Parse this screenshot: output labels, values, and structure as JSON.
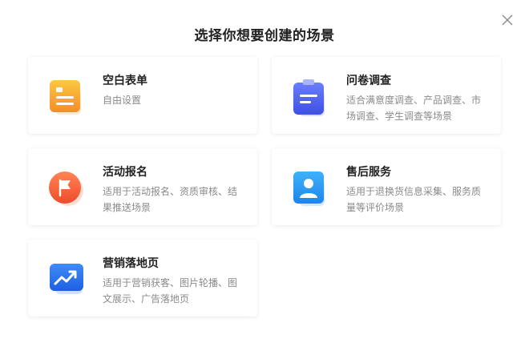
{
  "dialog": {
    "title": "选择你想要创建的场景",
    "close_icon": "close-icon"
  },
  "cards": [
    {
      "title": "空白表单",
      "description": "自由设置",
      "icon": "blank-form-icon",
      "color": "#F8A531"
    },
    {
      "title": "问卷调查",
      "description": "适合满意度调查、产品调查、市场调查、学生调查等场景",
      "icon": "clipboard-survey-icon",
      "color": "#5468F5"
    },
    {
      "title": "活动报名",
      "description": "适用于活动报名、资质审核、结果推送场景",
      "icon": "flag-icon",
      "color": "#F5623A"
    },
    {
      "title": "售后服务",
      "description": "适用于退换货信息采集、服务质量等评价场景",
      "icon": "user-badge-icon",
      "color": "#2E9CF2"
    },
    {
      "title": "营销落地页",
      "description": "适用于营销获客、图片轮播、图文展示、广告落地页",
      "icon": "trend-chart-icon",
      "color": "#2F75EE"
    }
  ]
}
